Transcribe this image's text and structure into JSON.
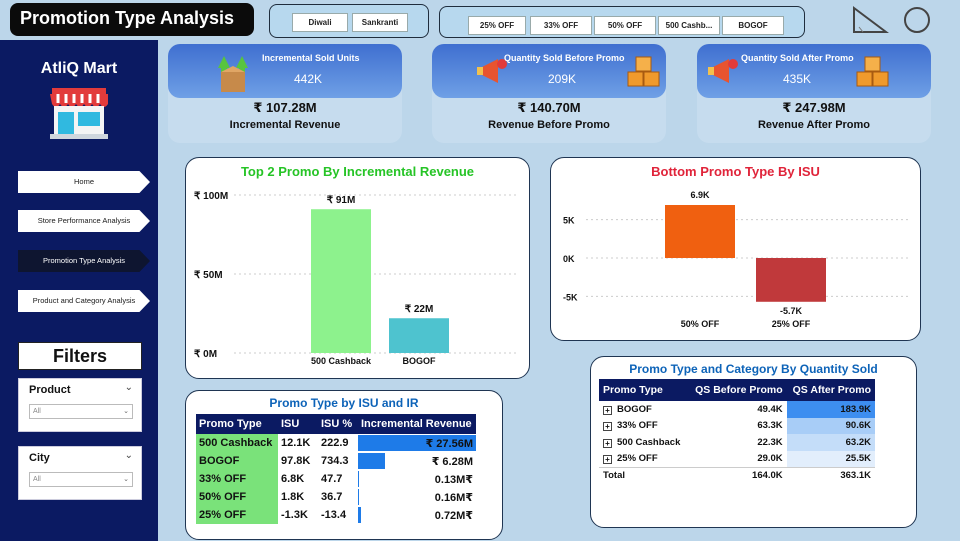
{
  "header": {
    "title": "Promotion Type Analysis",
    "festival_chips": [
      "Diwali",
      "Sankranti"
    ],
    "promo_chips": [
      "25% OFF",
      "33% OFF",
      "50% OFF",
      "500 Cashb...",
      "BOGOF"
    ]
  },
  "sidebar": {
    "brand": "AtliQ Mart",
    "nav": [
      "Home",
      "Store Performance Analysis",
      "Promotion Type Analysis",
      "Product and Category Analysis"
    ],
    "active_nav": "Promotion Type Analysis",
    "filters_title": "Filters",
    "filters": [
      {
        "label": "Product",
        "value": "All"
      },
      {
        "label": "City",
        "value": "All"
      }
    ]
  },
  "kpis": [
    {
      "top_label": "Incremental Sold Units",
      "top_value": "442K",
      "main_value": "₹ 107.28M",
      "sub_label": "Incremental Revenue"
    },
    {
      "top_label": "Quantity Sold Before Promo",
      "top_value": "209K",
      "main_value": "₹ 140.70M",
      "sub_label": "Revenue Before Promo"
    },
    {
      "top_label": "Quantity Sold After Promo",
      "top_value": "435K",
      "main_value": "₹ 247.98M",
      "sub_label": "Revenue After Promo"
    }
  ],
  "colors": {
    "sidebar": "#0b1a62",
    "bar_cashback": "#8df28d",
    "bar_bogof": "#4ec3cf",
    "bar_positive": "#f06010",
    "bar_negative": "#c0393b",
    "title_green": "#26c426",
    "title_red": "#e0243a",
    "title_blue": "#0d63b8"
  },
  "chart_data": [
    {
      "type": "bar",
      "title": "Top 2 Promo By Incremental Revenue",
      "categories": [
        "500 Cashback",
        "BOGOF"
      ],
      "values": [
        91,
        22
      ],
      "data_labels": [
        "₹ 91M",
        "₹ 22M"
      ],
      "yticks": [
        "₹ 100M",
        "₹ 50M",
        "₹ 0M"
      ],
      "ylim": [
        0,
        100
      ],
      "grid": true
    },
    {
      "type": "bar",
      "title": "Bottom Promo Type By ISU",
      "categories": [
        "50% OFF",
        "25% OFF"
      ],
      "values": [
        6.9,
        -5.7
      ],
      "data_labels": [
        "6.9K",
        "-5.7K"
      ],
      "yticks": [
        "5K",
        "0K",
        "-5K"
      ],
      "ylim": [
        -5.7,
        6.9
      ],
      "grid": true
    }
  ],
  "isu_table": {
    "title": "Promo Type by ISU and IR",
    "columns": [
      "Promo Type",
      "ISU",
      "ISU %",
      "Incremental Revenue"
    ],
    "rows": [
      {
        "promo": "500 Cashback",
        "isu": "12.1K",
        "isu_pct": "222.9",
        "ir": "₹ 27.56M",
        "ir_frac": 1.0
      },
      {
        "promo": "BOGOF",
        "isu": "97.8K",
        "isu_pct": "734.3",
        "ir": "₹ 6.28M",
        "ir_frac": 0.23
      },
      {
        "promo": "33% OFF",
        "isu": "6.8K",
        "isu_pct": "47.7",
        "ir": "0.13M₹",
        "ir_frac": 0.005
      },
      {
        "promo": "50% OFF",
        "isu": "1.8K",
        "isu_pct": "36.7",
        "ir": "0.16M₹",
        "ir_frac": 0.006
      },
      {
        "promo": "25% OFF",
        "isu": "-1.3K",
        "isu_pct": "-13.4",
        "ir": "0.72M₹",
        "ir_frac": 0.026
      }
    ]
  },
  "qs_table": {
    "title": "Promo Type and Category By Quantity Sold",
    "columns": [
      "Promo Type",
      "QS Before Promo",
      "QS After Promo"
    ],
    "rows": [
      {
        "promo": "BOGOF",
        "before": "49.4K",
        "after": "183.9K",
        "shade": "#3d8ef0"
      },
      {
        "promo": "33% OFF",
        "before": "63.3K",
        "after": "90.6K",
        "shade": "#a8cdf7"
      },
      {
        "promo": "500 Cashback",
        "before": "22.3K",
        "after": "63.2K",
        "shade": "#c4ddf9"
      },
      {
        "promo": "25% OFF",
        "before": "29.0K",
        "after": "25.5K",
        "shade": "#e2eefc"
      }
    ],
    "total": {
      "label": "Total",
      "before": "164.0K",
      "after": "363.1K"
    }
  }
}
